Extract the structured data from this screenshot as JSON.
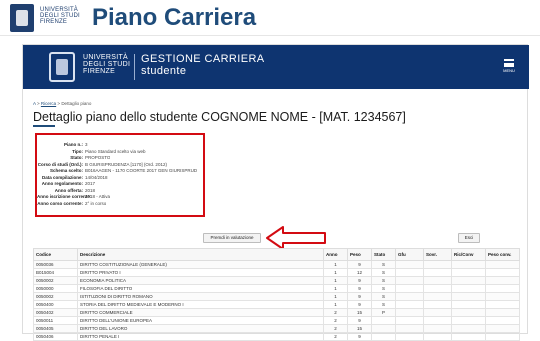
{
  "doc_header": {
    "university_lines": [
      "UNIVERSITÀ",
      "DEGLI STUDI",
      "FIRENZE"
    ],
    "title": "Piano Carriera"
  },
  "app": {
    "university_lines": [
      "UNIVERSITÀ",
      "DEGLI STUDI",
      "FIRENZE"
    ],
    "app_name_lines": [
      "GESTIONE CARRIERA",
      "studente"
    ],
    "menu_label": "MENU",
    "colors": {
      "banner": "#0e3470",
      "highlight": "#d30b12"
    }
  },
  "breadcrumb": {
    "home": "A",
    "separator": " > ",
    "link": "Ricerca",
    "current": "Dettaglio piano"
  },
  "page_title": "Dettaglio piano dello studente COGNOME NOME - [MAT. 1234567]",
  "info": [
    {
      "key": "Piano n.:",
      "value": "3"
    },
    {
      "key": "Tipo:",
      "value": "Piano Standard scelto via web"
    },
    {
      "key": "Stato:",
      "value": "PROPOSTO"
    },
    {
      "key": "Corso di studi (Ord.):",
      "value": "B GIURISPRUDENZA [1170] (Ord. 2012)"
    },
    {
      "key": "Schema scelto:",
      "value": "B016AAGEN - 1170 COORTE 2017 GEN GIURISPRUDENZA 1170 2017"
    },
    {
      "key": "Data compilazione:",
      "value": "14/04/2018"
    },
    {
      "key": "Anno regolamento:",
      "value": "2017"
    },
    {
      "key": "Anno offerta:",
      "value": "2018"
    },
    {
      "key": "Anno iscrizione corrente:",
      "value": "2018 - Attiva"
    },
    {
      "key": "Anno corso corrente:",
      "value": "2° in corso"
    }
  ],
  "buttons": {
    "evaluate": "Premdi in valutazione",
    "exit": "Esci"
  },
  "table": {
    "headers": [
      "Codice",
      "Descrizione",
      "Anno",
      "Peso",
      "Stato",
      "Gfu",
      "Sovr.",
      "Ric/Conv",
      "Peso conv."
    ],
    "rows": [
      [
        "0050036",
        "DIRITTO COSTITUZIONALE (GENERALE)",
        "1",
        "9",
        "S",
        "",
        "",
        "",
        ""
      ],
      [
        "B015004",
        "DIRITTO PRIVATO I",
        "1",
        "12",
        "S",
        "",
        "",
        "",
        ""
      ],
      [
        "0050002",
        "ECONOMIA POLITICA",
        "1",
        "9",
        "S",
        "",
        "",
        "",
        ""
      ],
      [
        "0050000",
        "FILOSOFIA DEL DIRITTO",
        "1",
        "9",
        "S",
        "",
        "",
        "",
        ""
      ],
      [
        "0050002",
        "ISTITUZIONI DI DIRITTO ROMANO",
        "1",
        "9",
        "S",
        "",
        "",
        "",
        ""
      ],
      [
        "0050400",
        "STORIA DEL DIRITTO MEDIEVALE E MODERNO I",
        "1",
        "9",
        "S",
        "",
        "",
        "",
        ""
      ],
      [
        "0050402",
        "DIRITTO COMMERCIALE",
        "2",
        "15",
        "P",
        "",
        "",
        "",
        ""
      ],
      [
        "0050011",
        "DIRITTO DELL'UNIONE EUROPEA",
        "2",
        "9",
        "",
        "",
        "",
        "",
        ""
      ],
      [
        "0050405",
        "DIRITTO DEL LAVORO",
        "2",
        "15",
        "",
        "",
        "",
        "",
        ""
      ],
      [
        "0050406",
        "DIRITTO PENALE I",
        "2",
        "9",
        "",
        "",
        "",
        "",
        ""
      ]
    ]
  }
}
